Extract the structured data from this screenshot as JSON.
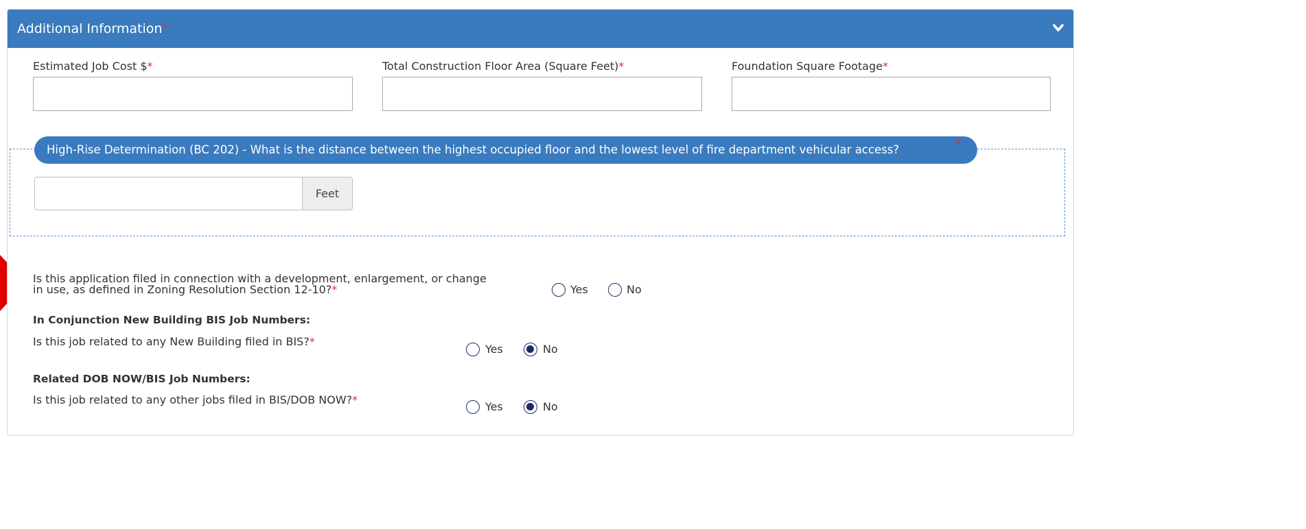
{
  "section": {
    "title": "Additional Information",
    "required_mark": "*"
  },
  "fields": {
    "job_cost": {
      "label": "Estimated Job Cost $",
      "value": ""
    },
    "floor_area": {
      "label": "Total Construction Floor Area (Square Feet)",
      "value": ""
    },
    "foundation": {
      "label": "Foundation Square Footage",
      "value": ""
    }
  },
  "high_rise": {
    "legend": "High-Rise Determination (BC 202) - What is the distance between the highest occupied floor and the lowest level of fire department vehicular access?",
    "value": "",
    "unit": "Feet"
  },
  "questions": {
    "zoning": {
      "line1": "Is this application filed in connection with a development, enlargement, or change",
      "line2": "in use, as defined in Zoning Resolution Section 12-10?",
      "yes": "Yes",
      "no": "No",
      "selected": "none"
    },
    "nb_heading": "In Conjunction New Building BIS Job Numbers:",
    "nb": {
      "text": "Is this job related to any New Building filed in BIS?",
      "yes": "Yes",
      "no": "No",
      "selected": "No"
    },
    "related_heading": "Related DOB NOW/BIS Job Numbers:",
    "related": {
      "text": "Is this job related to any other jobs filed in BIS/DOB NOW?",
      "yes": "Yes",
      "no": "No",
      "selected": "No"
    }
  },
  "colors": {
    "header": "#3a7bbf",
    "required": "#e03131",
    "radio": "#1e2a63",
    "arrow": "#e00000"
  },
  "icons": {
    "collapse": "chevron-down-icon",
    "pointer": "red-arrow-indicator"
  }
}
